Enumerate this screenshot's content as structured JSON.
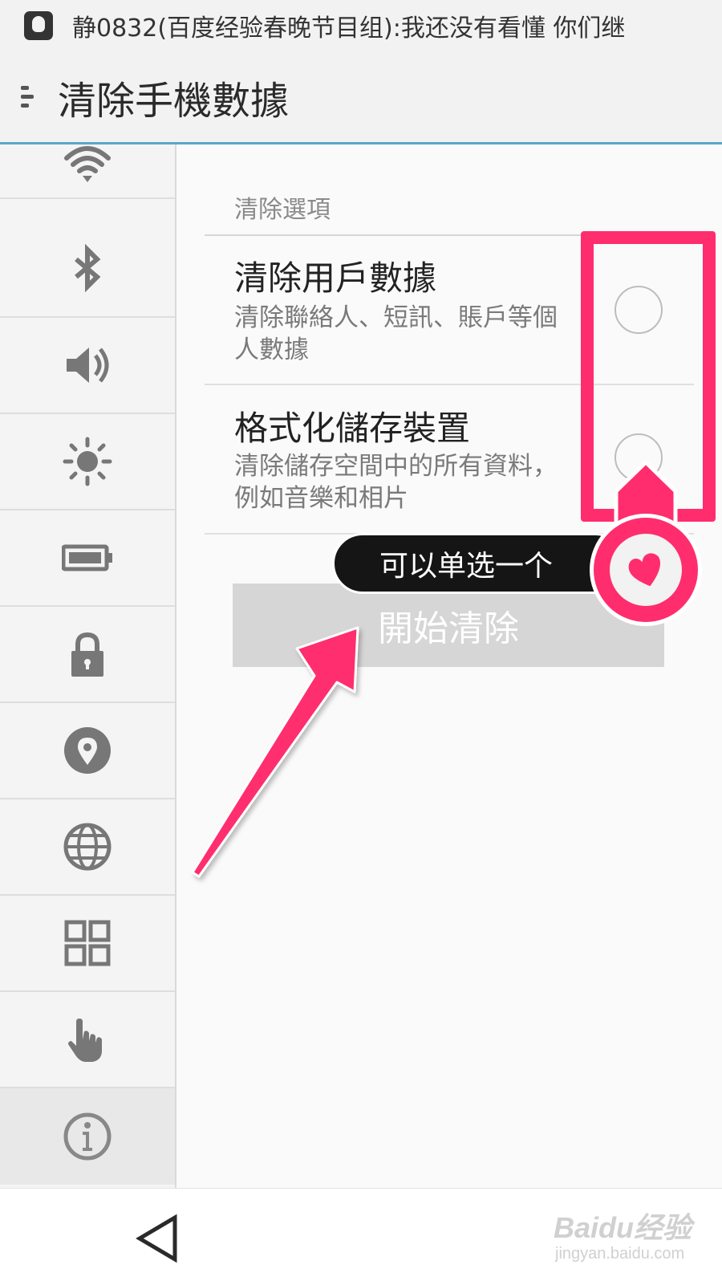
{
  "status_bar": {
    "notification": "静0832(百度经验春晚节目组):我还没有看懂 你们继"
  },
  "header": {
    "title": "清除手機數據"
  },
  "sidebar": {
    "items": [
      {
        "icon": "wifi-icon"
      },
      {
        "icon": "bluetooth-icon"
      },
      {
        "icon": "volume-icon"
      },
      {
        "icon": "brightness-icon"
      },
      {
        "icon": "battery-icon"
      },
      {
        "icon": "lock-icon"
      },
      {
        "icon": "location-icon"
      },
      {
        "icon": "globe-icon"
      },
      {
        "icon": "apps-grid-icon"
      },
      {
        "icon": "hand-gesture-icon"
      },
      {
        "icon": "info-icon",
        "active": true
      }
    ]
  },
  "main": {
    "section_title": "清除選項",
    "options": [
      {
        "title": "清除用戶數據",
        "description": "清除聯絡人、短訊、賬戶等個人數據",
        "selected": false
      },
      {
        "title": "格式化儲存裝置",
        "description": "清除儲存空間中的所有資料，例如音樂和相片",
        "selected": false
      }
    ],
    "start_button": "開始清除"
  },
  "annotation": {
    "tooltip": "可以单选一个",
    "color": "#ff2d6e"
  },
  "watermark": {
    "main": "Baidu经验",
    "sub": "jingyan.baidu.com"
  }
}
